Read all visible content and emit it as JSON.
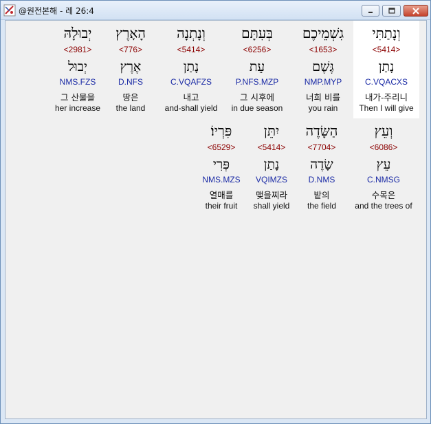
{
  "window": {
    "title": "@원전본해 - 레 26:4"
  },
  "rows": [
    [
      {
        "hebrew": "וְנָתַתִּי",
        "strong": "<5414>",
        "lemma": "נָתַן",
        "parse": "C.VQACXS",
        "korean": "내가-주리니",
        "english": "Then I will give",
        "selected": true
      },
      {
        "hebrew": "גִשְׁמֵיכֶם",
        "strong": "<1653>",
        "lemma": "גֶּשֶׁם",
        "parse": "NMP.MYP",
        "korean": "너희 비를",
        "english": "you rain",
        "selected": false
      },
      {
        "hebrew": "בְּעִתָּם",
        "strong": "<6256>",
        "lemma": "עֵת",
        "parse": "P.NFS.MZP",
        "korean": "그 시후에",
        "english": "in due season",
        "selected": false
      },
      {
        "hebrew": "וְנָתְנָה",
        "strong": "<5414>",
        "lemma": "נָתַן",
        "parse": "C.VQAFZS",
        "korean": "내고",
        "english": "and-shall yield",
        "selected": false
      },
      {
        "hebrew": "הָאָרֶץ",
        "strong": "<776>",
        "lemma": "אֶרֶץ",
        "parse": "D.NFS",
        "korean": "땅은",
        "english": "the land",
        "selected": false
      },
      {
        "hebrew": "יְבוּלָהּ",
        "strong": "<2981>",
        "lemma": "יְבוּל",
        "parse": "NMS.FZS",
        "korean": "그 산물을",
        "english": "her increase",
        "selected": false
      }
    ],
    [
      {
        "hebrew": "וְעֵץ",
        "strong": "<6086>",
        "lemma": "עֵץ",
        "parse": "C.NMSG",
        "korean": "수목은",
        "english": "and the trees of",
        "selected": false
      },
      {
        "hebrew": "הַשָּׂדֶה",
        "strong": "<7704>",
        "lemma": "שָׂדֶה",
        "parse": "D.NMS",
        "korean": "밭의",
        "english": "the field",
        "selected": false
      },
      {
        "hebrew": "יִתֵּן",
        "strong": "<5414>",
        "lemma": "נָתַן",
        "parse": "VQIMZS",
        "korean": "맺을찌라",
        "english": "shall yield",
        "selected": false
      },
      {
        "hebrew": "פִּרְיוֹ׃",
        "strong": "<6529>",
        "lemma": "פְּרִי",
        "parse": "NMS.MZS",
        "korean": "열매를",
        "english": "their fruit",
        "selected": false
      }
    ]
  ]
}
